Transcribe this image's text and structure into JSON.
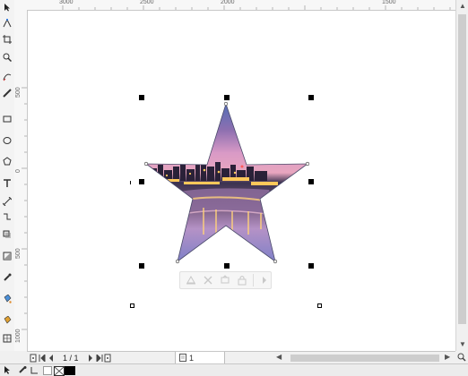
{
  "ruler_top": {
    "labels": [
      "3000",
      "2500",
      "2000",
      "1500"
    ]
  },
  "ruler_left": {
    "labels": [
      "500",
      "0",
      "500",
      "1000"
    ]
  },
  "page_nav": {
    "page_count": "1 / 1"
  },
  "page_tab": {
    "label": "1"
  },
  "toolbox": {
    "tools": [
      "pick-tool-icon",
      "shape-tool-icon",
      "crop-tool-icon",
      "zoom-tool-icon",
      "freehand-tool-icon",
      "artistic-media-icon",
      "rectangle-tool-icon",
      "ellipse-tool-icon",
      "polygon-tool-icon",
      "text-tool-icon",
      "parallel-dimension-icon",
      "connector-tool-icon",
      "drop-shadow-icon",
      "transparency-icon",
      "eyedropper-icon",
      "interactive-fill-icon",
      "smart-fill-icon"
    ]
  },
  "colors": {
    "selection": "#000000",
    "canvas": "#ffffff",
    "chrome": "#f0f0f0"
  }
}
